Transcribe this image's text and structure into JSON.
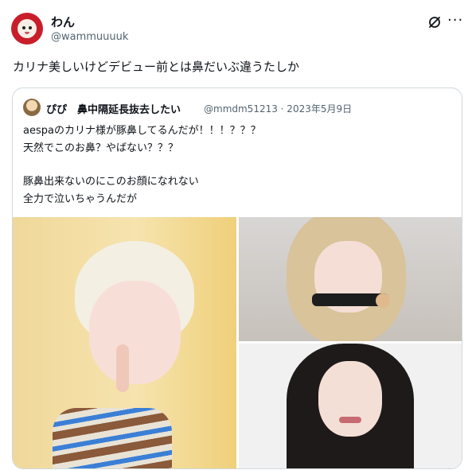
{
  "tweet": {
    "author_name": "わん",
    "author_handle": "@wammuuuuk",
    "text": "カリナ美しいけどデビュー前とは鼻だいぶ違うたしか"
  },
  "quoted": {
    "author_name": "ぴぴ　鼻中隔延長抜去したい",
    "author_handle": "@mmdm51213 · 2023年5月9日",
    "lines": [
      "aespaのカリナ様が豚鼻してるんだが！！！？？？",
      "天然でこのお鼻？やばない？？？",
      "豚鼻出来ないのにこのお顔になれない",
      "全力で泣いちゃうんだが"
    ]
  },
  "icons": {
    "grok": "grok-icon",
    "more": "more-icon"
  }
}
